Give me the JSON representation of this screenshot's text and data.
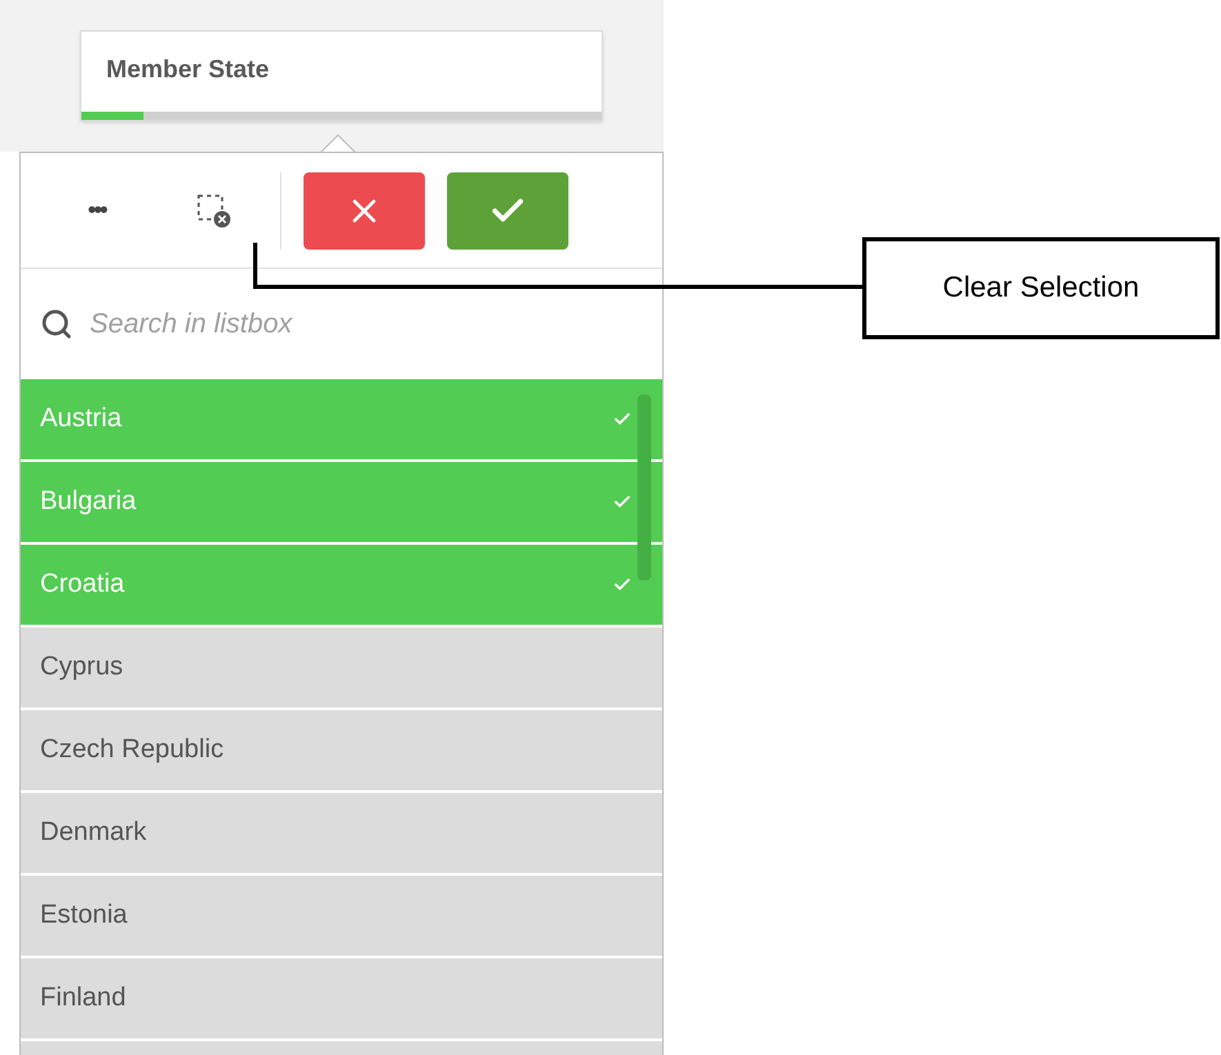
{
  "header": {
    "title": "Member State",
    "selection_bar": {
      "level": 0.12
    }
  },
  "toolbar": {
    "more": "•••"
  },
  "search": {
    "placeholder": "Search in listbox"
  },
  "items": [
    {
      "label": "Austria",
      "selected": true
    },
    {
      "label": "Bulgaria",
      "selected": true
    },
    {
      "label": "Croatia",
      "selected": true
    },
    {
      "label": "Cyprus",
      "selected": false
    },
    {
      "label": "Czech Republic",
      "selected": false
    },
    {
      "label": "Denmark",
      "selected": false
    },
    {
      "label": "Estonia",
      "selected": false
    },
    {
      "label": "Finland",
      "selected": false
    }
  ],
  "callout": {
    "text": "Clear Selection"
  }
}
